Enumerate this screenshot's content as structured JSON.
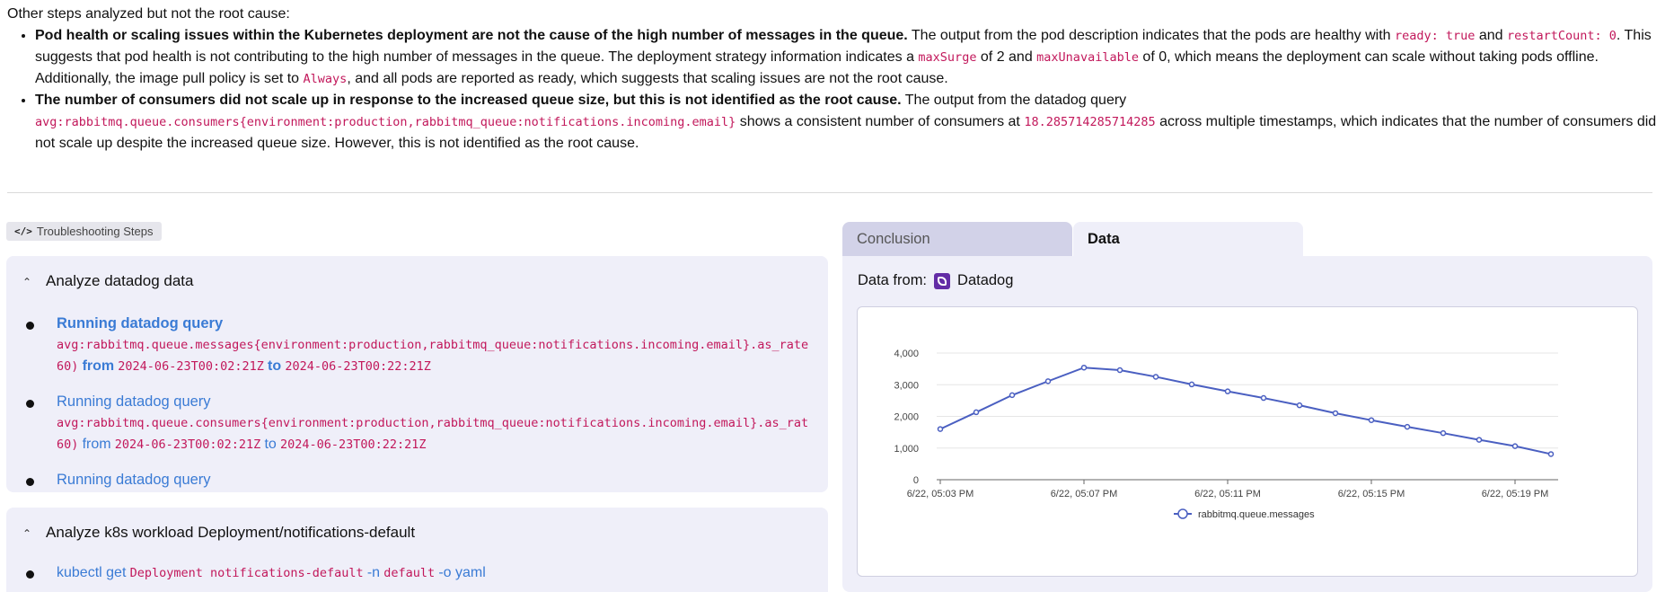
{
  "summary": {
    "heading": "Other steps analyzed but not the root cause:",
    "item1": {
      "bold": "Pod health or scaling issues within the Kubernetes deployment are not the cause of the high number of messages in the queue.",
      "t1": " The output from the pod description indicates that the pods are healthy with ",
      "c1": "ready: true",
      "t2": " and ",
      "c2": "restartCount: 0",
      "t3": ". This suggests that pod health is not contributing to the high number of messages in the queue. The deployment strategy information indicates a ",
      "c3": "maxSurge",
      "t4": " of 2 and ",
      "c4": "maxUnavailable",
      "t5": " of 0, which means the deployment can scale without taking pods offline. Additionally, the image pull policy is set to ",
      "c5": "Always",
      "t6": ", and all pods are reported as ready, which suggests that scaling issues are not the root cause."
    },
    "item2": {
      "bold": "The number of consumers did not scale up in response to the increased queue size, but this is not identified as the root cause.",
      "t1": " The output from the datadog query ",
      "c1": "avg:rabbitmq.queue.consumers{environment:production,rabbitmq_queue:notifications.incoming.email}",
      "t2": " shows a consistent number of consumers at ",
      "c2": "18.285714285714285",
      "t3": " across multiple timestamps, which indicates that the number of consumers did not scale up despite the increased queue size. However, this is not identified as the root cause."
    }
  },
  "troubleshooting": {
    "badge": "Troubleshooting Steps",
    "sections": [
      {
        "title": "Analyze datadog data",
        "steps": [
          {
            "title": "Running datadog query",
            "query": "avg:rabbitmq.queue.messages{environment:production,rabbitmq_queue:notifications.incoming.email}.as_rate",
            "query_cont": "60)",
            "from_label": "from",
            "from": "2024-06-23T00:02:21Z",
            "to_label": "to",
            "to": "2024-06-23T00:22:21Z"
          },
          {
            "title": "Running datadog query",
            "query": "avg:rabbitmq.queue.consumers{environment:production,rabbitmq_queue:notifications.incoming.email}.as_rat",
            "query_cont": "60)",
            "from_label": "from",
            "from": "2024-06-23T00:02:21Z",
            "to_label": "to",
            "to": "2024-06-23T00:22:21Z"
          },
          {
            "title": "Running datadog query"
          }
        ]
      },
      {
        "title": "Analyze k8s workload Deployment/notifications-default",
        "steps": [
          {
            "cmd1": "kubectl get",
            "code1": "Deployment notifications-default",
            "cmd2": "-n",
            "code2": "default",
            "cmd3": "-o yaml"
          }
        ]
      }
    ]
  },
  "result_panel": {
    "tabs": [
      "Conclusion",
      "Data"
    ],
    "active_tab": "Data",
    "data_from_label": "Data from:",
    "source_name": "Datadog",
    "logo_color": "#632ca6"
  },
  "chart_data": {
    "type": "line",
    "title": "",
    "xlabel": "",
    "ylabel": "",
    "ylim": [
      0,
      4000
    ],
    "y_ticks": [
      "0",
      "1,000",
      "2,000",
      "3,000",
      "4,000"
    ],
    "x_tick_labels": [
      "6/22, 05:03 PM",
      "6/22, 05:07 PM",
      "6/22, 05:11 PM",
      "6/22, 05:15 PM",
      "6/22, 05:19 PM"
    ],
    "x": [
      "6/22, 05:03 PM",
      "6/22, 05:04 PM",
      "6/22, 05:05 PM",
      "6/22, 05:06 PM",
      "6/22, 05:07 PM",
      "6/22, 05:08 PM",
      "6/22, 05:09 PM",
      "6/22, 05:10 PM",
      "6/22, 05:11 PM",
      "6/22, 05:12 PM",
      "6/22, 05:13 PM",
      "6/22, 05:14 PM",
      "6/22, 05:15 PM",
      "6/22, 05:16 PM",
      "6/22, 05:17 PM",
      "6/22, 05:18 PM",
      "6/22, 05:19 PM",
      "6/22, 05:20 PM"
    ],
    "series": [
      {
        "name": "rabbitmq.queue.messages",
        "color": "#4a5fc1",
        "values": [
          1600,
          2130,
          2670,
          3110,
          3540,
          3460,
          3250,
          3010,
          2790,
          2580,
          2350,
          2100,
          1880,
          1670,
          1470,
          1260,
          1060,
          810
        ]
      }
    ],
    "grid": true,
    "legend": "bottom"
  }
}
